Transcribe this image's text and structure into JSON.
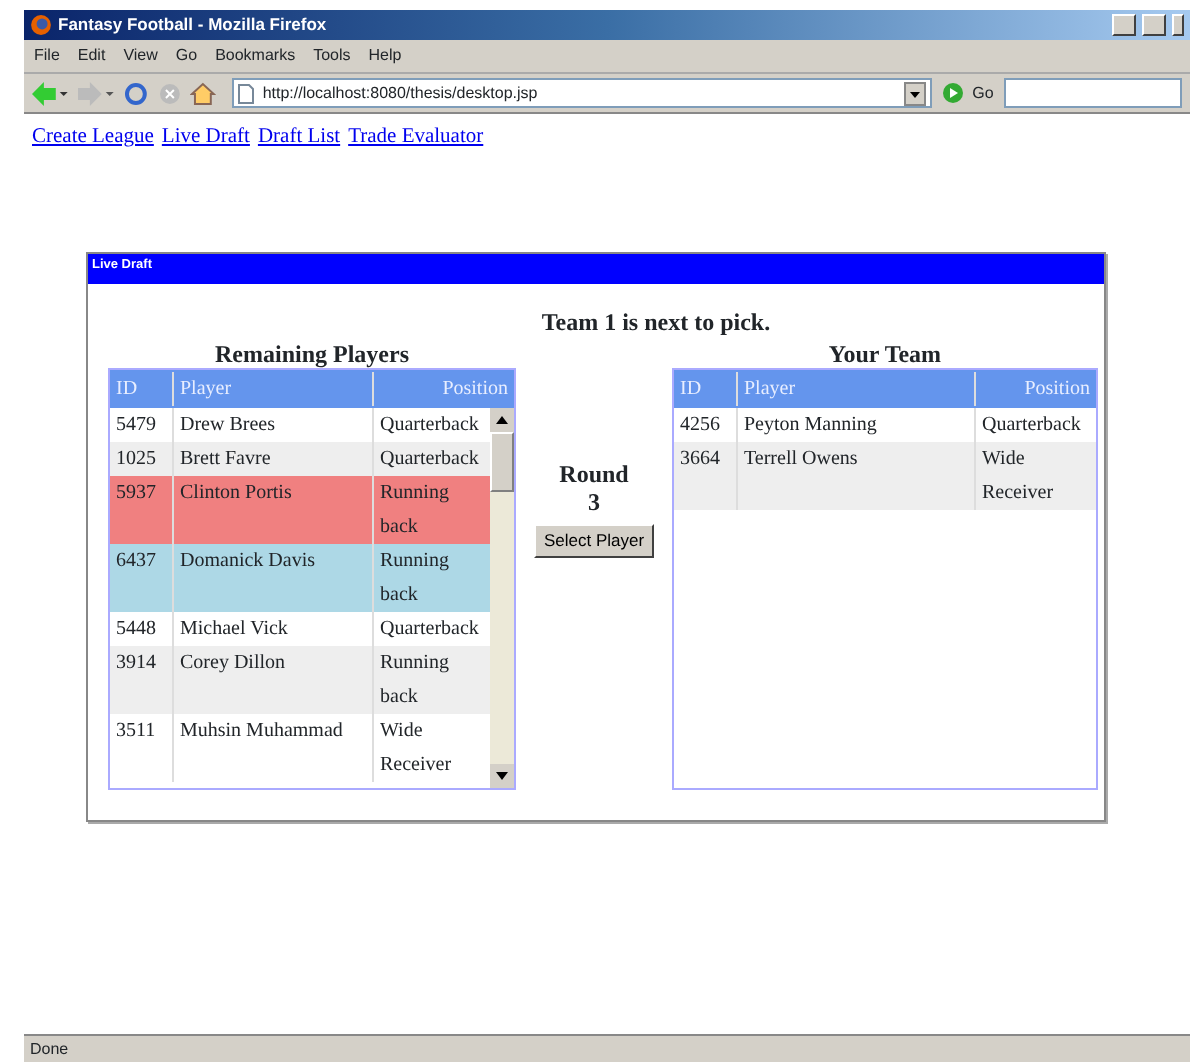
{
  "window": {
    "title": "Fantasy Football - Mozilla Firefox",
    "menu": [
      "File",
      "Edit",
      "View",
      "Go",
      "Bookmarks",
      "Tools",
      "Help"
    ],
    "address": "http://localhost:8080/thesis/desktop.jsp",
    "go_label": "Go",
    "status": "Done"
  },
  "nav_links": [
    "Create League",
    "Live Draft",
    "Draft List",
    "Trade Evaluator"
  ],
  "panel": {
    "title": "Live Draft",
    "message": "Team 1 is next to pick.",
    "remaining": {
      "heading": "Remaining Players",
      "columns": [
        "ID",
        "Player",
        "Position"
      ],
      "rows": [
        {
          "id": "5479",
          "player": "Drew Brees",
          "position": "Quarterback",
          "selected": false,
          "hovered": false
        },
        {
          "id": "1025",
          "player": "Brett Favre",
          "position": "Quarterback",
          "selected": false,
          "hovered": false
        },
        {
          "id": "5937",
          "player": "Clinton Portis",
          "position": "Running back",
          "selected": true,
          "hovered": false
        },
        {
          "id": "6437",
          "player": "Domanick Davis",
          "position": "Running back",
          "selected": false,
          "hovered": true
        },
        {
          "id": "5448",
          "player": "Michael Vick",
          "position": "Quarterback",
          "selected": false,
          "hovered": false
        },
        {
          "id": "3914",
          "player": "Corey Dillon",
          "position": "Running back",
          "selected": false,
          "hovered": false
        },
        {
          "id": "3511",
          "player": "Muhsin Muhammad",
          "position": "Wide Receiver",
          "selected": false,
          "hovered": false
        }
      ]
    },
    "round": {
      "label": "Round",
      "value": "3"
    },
    "select_button": "Select Player",
    "team": {
      "heading": "Your Team",
      "columns": [
        "ID",
        "Player",
        "Position"
      ],
      "rows": [
        {
          "id": "4256",
          "player": "Peyton Manning",
          "position": "Quarterback"
        },
        {
          "id": "3664",
          "player": "Terrell Owens",
          "position": "Wide Receiver"
        }
      ]
    }
  }
}
